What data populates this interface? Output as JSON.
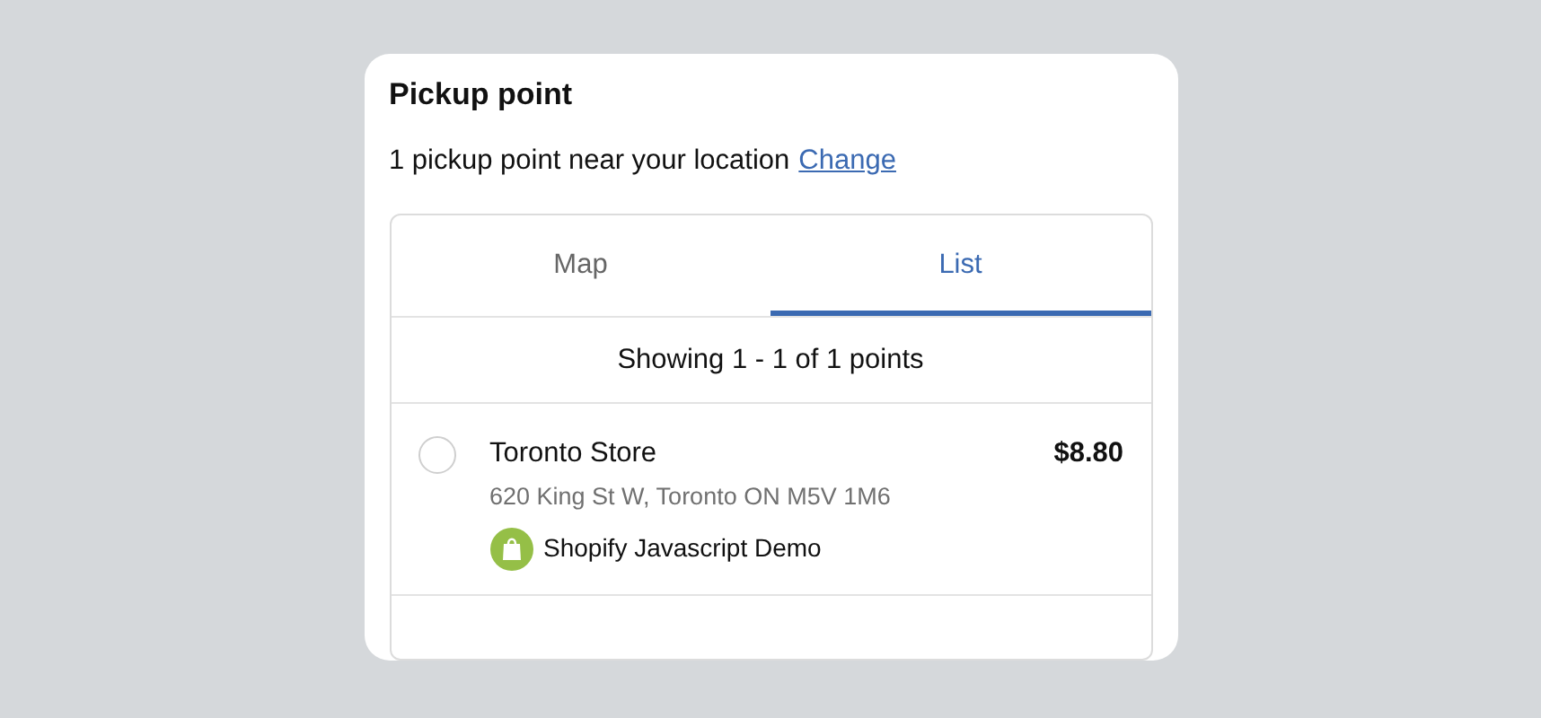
{
  "title": "Pickup point",
  "summary": {
    "text": "1 pickup point near your location",
    "link": "Change"
  },
  "tabs": [
    {
      "label": "Map",
      "selected": false
    },
    {
      "label": "List",
      "selected": true
    }
  ],
  "showing": "Showing 1 - 1 of 1 points",
  "points": [
    {
      "name": "Toronto Store",
      "address": "620 King St W, Toronto ON M5V 1M6",
      "price": "$8.80",
      "shop": "Shopify Javascript Demo",
      "selected": false
    }
  ]
}
